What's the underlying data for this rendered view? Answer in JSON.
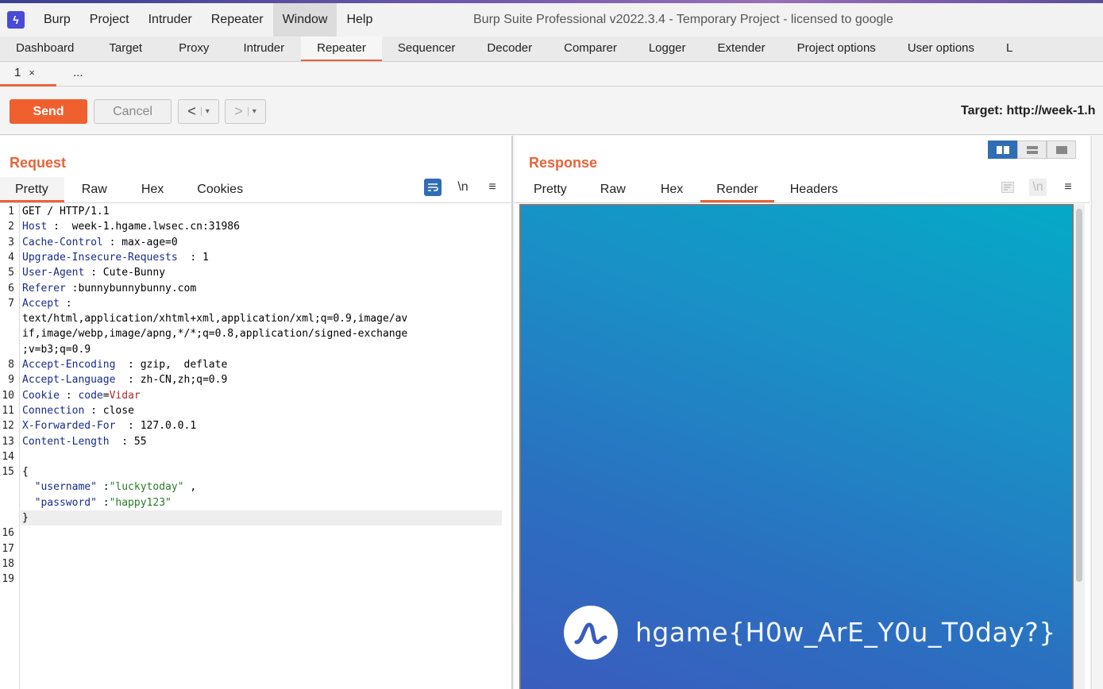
{
  "app": {
    "title": "Burp Suite Professional v2022.3.4 - Temporary Project - licensed to google",
    "logo_glyph": "ϟ"
  },
  "menu": [
    {
      "label": "Burp"
    },
    {
      "label": "Project"
    },
    {
      "label": "Intruder"
    },
    {
      "label": "Repeater"
    },
    {
      "label": "Window"
    },
    {
      "label": "Help"
    }
  ],
  "main_tabs": [
    {
      "label": "Dashboard"
    },
    {
      "label": "Target"
    },
    {
      "label": "Proxy"
    },
    {
      "label": "Intruder"
    },
    {
      "label": "Repeater"
    },
    {
      "label": "Sequencer"
    },
    {
      "label": "Decoder"
    },
    {
      "label": "Comparer"
    },
    {
      "label": "Logger"
    },
    {
      "label": "Extender"
    },
    {
      "label": "Project options"
    },
    {
      "label": "User options"
    },
    {
      "label": "L"
    }
  ],
  "sub_tabs": {
    "tab1": "1",
    "close": "×",
    "more": "..."
  },
  "toolbar": {
    "send": "Send",
    "cancel": "Cancel",
    "back": "<",
    "forward": ">",
    "dropdown": "▾",
    "target": "Target: http://week-1.h"
  },
  "request": {
    "title": "Request",
    "tabs": [
      "Pretty",
      "Raw",
      "Hex",
      "Cookies"
    ],
    "newline_icon": "\\n",
    "menu_icon": "≡",
    "lines": [
      {
        "n": "1",
        "parts": [
          {
            "t": "GET / HTTP/1.1",
            "c": ""
          }
        ]
      },
      {
        "n": "2",
        "parts": [
          {
            "t": "Host",
            "c": "k"
          },
          {
            "t": " :  week-1.hgame.lwsec.cn:31986",
            "c": ""
          }
        ]
      },
      {
        "n": "3",
        "parts": [
          {
            "t": "Cache-Control",
            "c": "k"
          },
          {
            "t": " : max-age=0",
            "c": ""
          }
        ]
      },
      {
        "n": "4",
        "parts": [
          {
            "t": "Upgrade-Insecure-Requests",
            "c": "k"
          },
          {
            "t": "  : 1",
            "c": ""
          }
        ]
      },
      {
        "n": "5",
        "parts": [
          {
            "t": "User-Agent",
            "c": "k"
          },
          {
            "t": " : Cute-Bunny",
            "c": ""
          }
        ]
      },
      {
        "n": "6",
        "parts": [
          {
            "t": "Referer",
            "c": "k"
          },
          {
            "t": " :bunnybunnybunny.com",
            "c": ""
          }
        ]
      },
      {
        "n": "7",
        "parts": [
          {
            "t": "Accept",
            "c": "k"
          },
          {
            "t": " :",
            "c": ""
          }
        ]
      },
      {
        "n": "",
        "parts": [
          {
            "t": "text/html,application/xhtml+xml,application/xml;q=0.9,image/av",
            "c": ""
          }
        ]
      },
      {
        "n": "",
        "parts": [
          {
            "t": "if,image/webp,image/apng,*/*;q=0.8,application/signed-exchange",
            "c": ""
          }
        ]
      },
      {
        "n": "",
        "parts": [
          {
            "t": ";v=b3;q=0.9",
            "c": ""
          }
        ]
      },
      {
        "n": "8",
        "parts": [
          {
            "t": "Accept-Encoding",
            "c": "k"
          },
          {
            "t": "  : gzip,  deflate",
            "c": ""
          }
        ]
      },
      {
        "n": "9",
        "parts": [
          {
            "t": "Accept-Language",
            "c": "k"
          },
          {
            "t": "  : zh-CN,zh;q=0.9",
            "c": ""
          }
        ]
      },
      {
        "n": "10",
        "parts": [
          {
            "t": "Cookie",
            "c": "k"
          },
          {
            "t": " : ",
            "c": ""
          },
          {
            "t": "code",
            "c": "v-blue"
          },
          {
            "t": "=",
            "c": ""
          },
          {
            "t": "Vidar",
            "c": "v-red"
          }
        ]
      },
      {
        "n": "11",
        "parts": [
          {
            "t": "Connection",
            "c": "k"
          },
          {
            "t": " : close",
            "c": ""
          }
        ]
      },
      {
        "n": "12",
        "parts": [
          {
            "t": "X-Forwarded-For",
            "c": "k"
          },
          {
            "t": "  : 127.0.0.1",
            "c": ""
          }
        ]
      },
      {
        "n": "13",
        "parts": [
          {
            "t": "Content-Length",
            "c": "k"
          },
          {
            "t": "  : 55",
            "c": ""
          }
        ]
      },
      {
        "n": "14",
        "parts": []
      },
      {
        "n": "15",
        "parts": [
          {
            "t": "{",
            "c": ""
          }
        ]
      },
      {
        "n": "",
        "parts": [
          {
            "t": "  \"username\"",
            "c": "k"
          },
          {
            "t": " :",
            "c": ""
          },
          {
            "t": "\"luckytoday\"",
            "c": "v-green"
          },
          {
            "t": " ,",
            "c": ""
          }
        ]
      },
      {
        "n": "",
        "parts": [
          {
            "t": "  \"password\"",
            "c": "k"
          },
          {
            "t": " :",
            "c": ""
          },
          {
            "t": "\"happy123\"",
            "c": "v-green"
          }
        ]
      },
      {
        "n": "",
        "parts": [
          {
            "t": "}",
            "c": ""
          }
        ]
      },
      {
        "n": "16",
        "parts": []
      },
      {
        "n": "17",
        "parts": []
      },
      {
        "n": "18",
        "parts": []
      },
      {
        "n": "19",
        "parts": []
      }
    ]
  },
  "response": {
    "title": "Response",
    "tabs": [
      "Pretty",
      "Raw",
      "Hex",
      "Render",
      "Headers"
    ],
    "active_tab": "Render",
    "newline_icon": "\\n",
    "menu_icon": "≡",
    "flag": "hgame{H0w_ArE_Y0u_T0day?}"
  },
  "colors": {
    "accent": "#e8643a",
    "send_button": "#f0602f",
    "selected_blue": "#2f6db5"
  }
}
